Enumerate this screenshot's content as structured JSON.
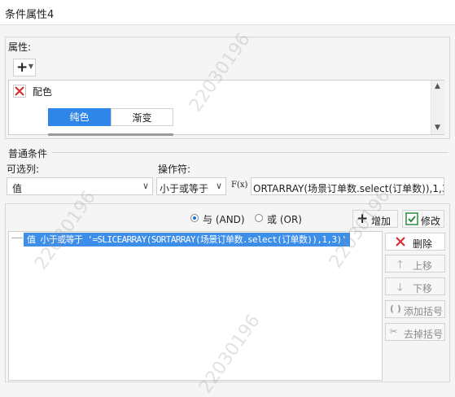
{
  "window": {
    "title": "条件属性4"
  },
  "properties": {
    "section_label": "属性:",
    "add_icon": "plus-icon",
    "item_label": "配色",
    "tabs": [
      "纯色",
      "渐变"
    ]
  },
  "conditions": {
    "section_label": "普通条件",
    "column_label": "可选列:",
    "column_value": "值",
    "operator_label": "操作符:",
    "operator_value": "小于或等于",
    "formula_button": "F(x)",
    "formula_value": "ORTARRAY(场景订单数.select(订单数)),1,3)",
    "and_label": "与 (AND)",
    "or_label": "或 (OR)",
    "add_label": "增加",
    "modify_label": "修改",
    "condition_text": "值 小于或等于 '=SLICEARRAY(SORTARRAY(场景订单数.select(订单数)),1,3)'",
    "delete_label": "删除",
    "up_label": "上移",
    "down_label": "下移",
    "add_paren_label": "添加括号",
    "remove_paren_label": "去掉括号"
  },
  "watermark": "22030196",
  "colors": {
    "selection": "#3d8ee8",
    "tab_active": "#2f86e8",
    "delete_red": "#d93030"
  }
}
